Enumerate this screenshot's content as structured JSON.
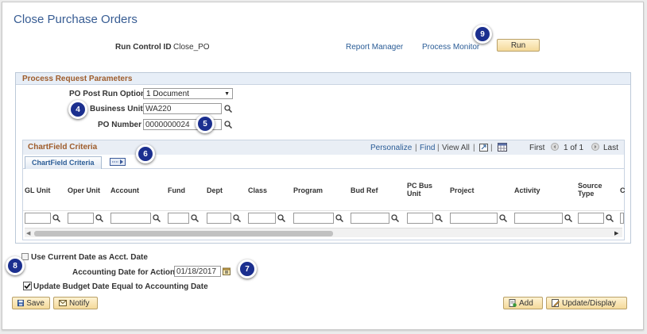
{
  "page": {
    "title": "Close Purchase Orders"
  },
  "run_control": {
    "label": "Run Control ID",
    "value": "Close_PO"
  },
  "links": {
    "report_manager": "Report Manager",
    "process_monitor": "Process Monitor"
  },
  "buttons": {
    "run": "Run",
    "save": "Save",
    "notify": "Notify",
    "add": "Add",
    "update_display": "Update/Display"
  },
  "params": {
    "header": "Process Request Parameters",
    "post_run_label": "PO Post Run Option",
    "post_run_value": "1 Document",
    "business_unit_label": "Business Unit",
    "business_unit_value": "WA220",
    "po_number_label": "PO Number",
    "po_number_value": "0000000024"
  },
  "chartfield": {
    "title": "ChartField Criteria",
    "tab": "ChartField Criteria",
    "nav": {
      "personalize": "Personalize",
      "find": "Find",
      "view_all": "View All",
      "first": "First",
      "count": "1 of 1",
      "last": "Last"
    },
    "columns": [
      "GL Unit",
      "Oper Unit",
      "Account",
      "Fund",
      "Dept",
      "Class",
      "Program",
      "Bud Ref",
      "PC Bus Unit",
      "Project",
      "Activity",
      "Source Type",
      "C"
    ]
  },
  "dates": {
    "use_current_label": "Use Current Date as Acct. Date",
    "use_current_checked": false,
    "acct_date_label": "Accounting Date for Action",
    "acct_date_value": "01/18/2017",
    "update_budget_label": "Update Budget Date Equal to Accounting Date",
    "update_budget_checked": true
  },
  "badges": {
    "b4": "4",
    "b5": "5",
    "b6": "6",
    "b7": "7",
    "b8": "8",
    "b9": "9"
  },
  "colors": {
    "title": "#375c93",
    "link": "#2a5c96",
    "section_header": "#9e5c2b",
    "badge": "#1b2f8f",
    "button_top": "#fff3d2",
    "button_bottom": "#f4d99a"
  }
}
